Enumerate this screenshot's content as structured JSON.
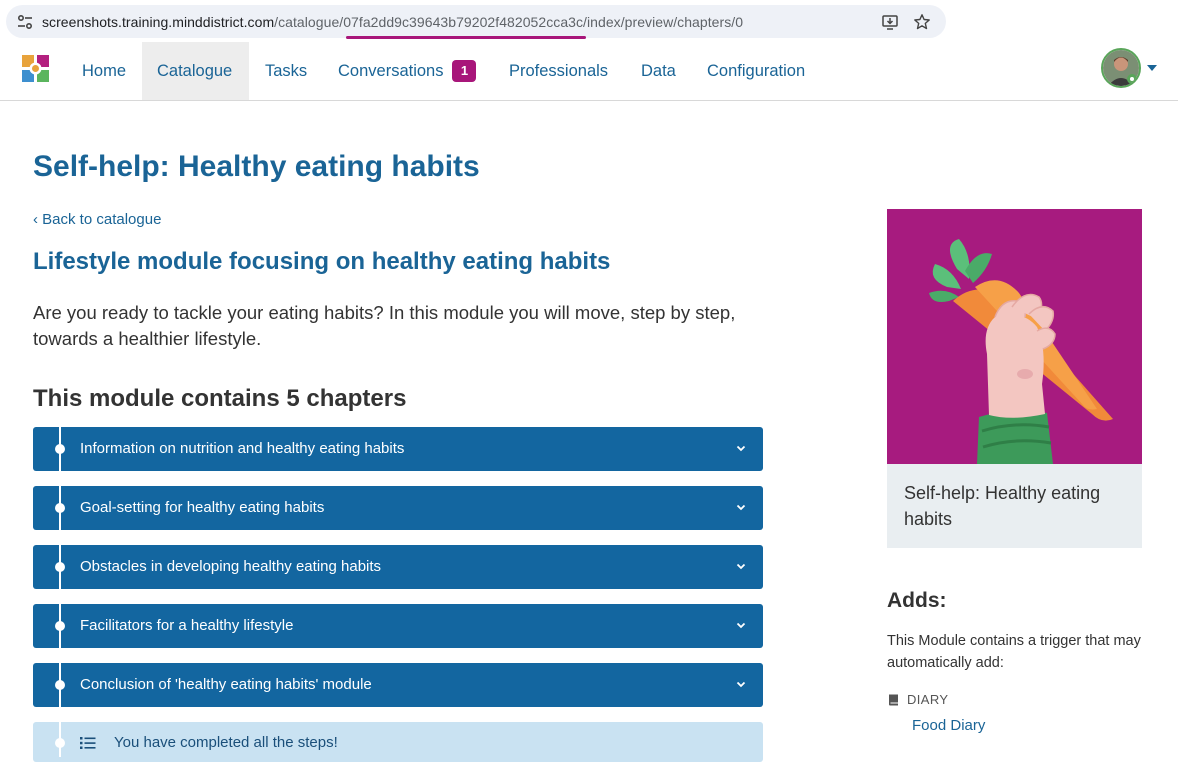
{
  "browser": {
    "url_host": "screenshots.training.minddistrict.com",
    "url_path_prefix": "/catalogue/",
    "url_highlight": "07fa2dd9c39643b79202f482052cca3c",
    "url_path_suffix": "/index/preview/chapters/0"
  },
  "nav": {
    "items": [
      {
        "label": "Home"
      },
      {
        "label": "Catalogue"
      },
      {
        "label": "Tasks"
      },
      {
        "label": "Conversations",
        "badge": "1"
      },
      {
        "label": "Professionals"
      },
      {
        "label": "Data"
      },
      {
        "label": "Configuration"
      }
    ],
    "active": "Catalogue"
  },
  "page": {
    "title": "Self-help: Healthy eating habits",
    "back_link": "Back to catalogue",
    "subtitle": "Lifestyle module focusing on healthy eating habits",
    "intro": "Are you ready to tackle your eating habits? In this module you will move, step by step, towards a healthier lifestyle.",
    "chapters_heading": "This module contains 5 chapters",
    "chapters": [
      {
        "label": "Information on nutrition and healthy eating habits"
      },
      {
        "label": "Goal-setting for healthy eating habits"
      },
      {
        "label": "Obstacles in developing healthy eating habits"
      },
      {
        "label": "Facilitators for a healthy lifestyle"
      },
      {
        "label": "Conclusion of 'healthy eating habits' module"
      }
    ],
    "completed_text": "You have completed all the steps!"
  },
  "sidebar": {
    "card_title": "Self-help: Healthy eating habits",
    "adds_heading": "Adds:",
    "adds_text": "This Module contains a trigger that may automatically add:",
    "diary_label": "DIARY",
    "diary_link": "Food Diary"
  },
  "colors": {
    "primary": "#1366a0",
    "accent": "#a8167a",
    "card_bg": "#e9eef1"
  }
}
